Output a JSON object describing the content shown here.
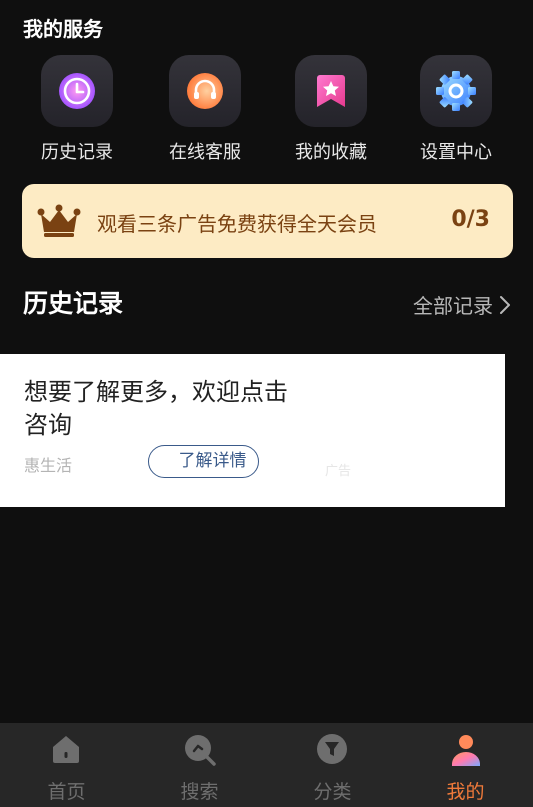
{
  "services": {
    "title": "我的服务",
    "items": [
      {
        "label": "历史记录",
        "icon": "history-clock-icon"
      },
      {
        "label": "在线客服",
        "icon": "headset-support-icon"
      },
      {
        "label": "我的收藏",
        "icon": "bookmark-star-icon"
      },
      {
        "label": "设置中心",
        "icon": "gear-settings-icon"
      }
    ]
  },
  "banner": {
    "text": "观看三条广告免费获得全天会员",
    "count": "0/3",
    "icon": "crown-icon",
    "bg_color": "#fdebc4",
    "text_color": "#7a4212"
  },
  "history": {
    "title": "历史记录",
    "all_link": "全部记录"
  },
  "ad": {
    "text": "想要了解更多，欢迎点击咨询",
    "source": "惠生活",
    "button": "了解详情",
    "tag": "广告"
  },
  "tabbar": {
    "items": [
      {
        "label": "首页",
        "icon": "home-icon"
      },
      {
        "label": "搜索",
        "icon": "search-icon"
      },
      {
        "label": "分类",
        "icon": "category-filter-icon"
      },
      {
        "label": "我的",
        "icon": "profile-user-icon"
      }
    ],
    "active_color": "#f07a3a"
  }
}
